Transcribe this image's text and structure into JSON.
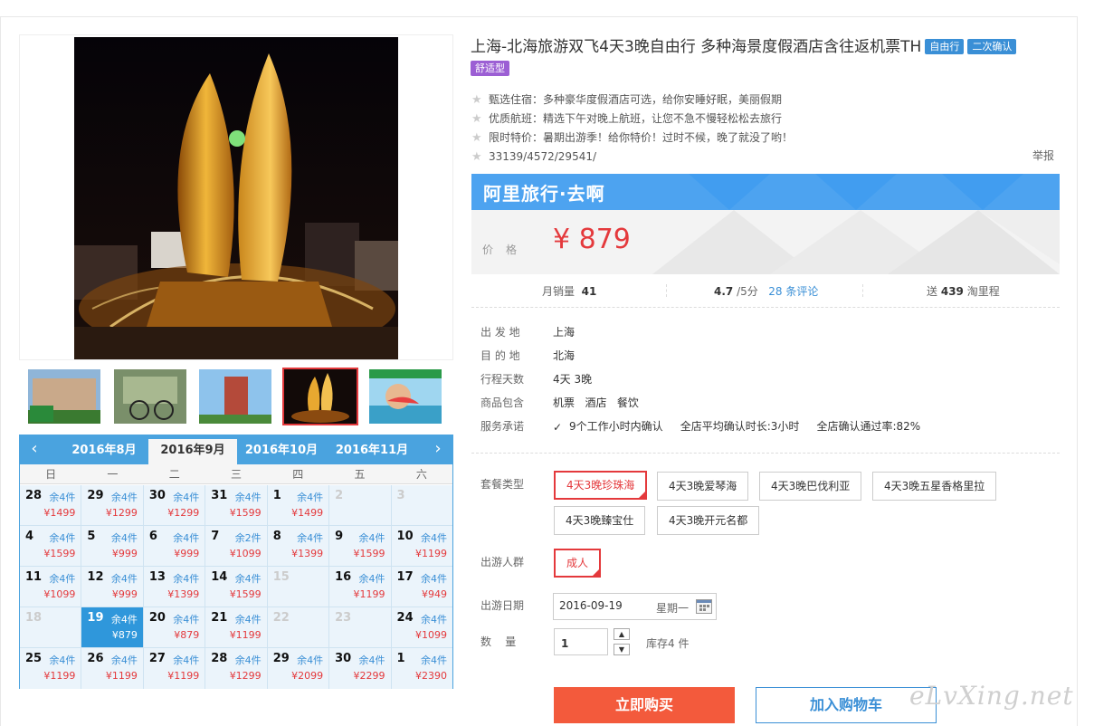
{
  "product": {
    "title": "上海-北海旅游双飞4天3晚自由行 多种海景度假酒店含往返机票TH",
    "tags": [
      "自由行",
      "二次确认",
      "舒适型"
    ],
    "features": [
      "甄选住宿：多种豪华度假酒店可选，给你安睡好眠，美丽假期",
      "优质航班：精选下午对晚上航班，让您不急不慢轻松松去旅行",
      "限时特价：暑期出游季！给你特价！过时不候，晚了就没了哟！",
      "33139/4572/29541/"
    ],
    "report": "举报"
  },
  "banner": {
    "brand": "阿里旅行·去啊",
    "price_label": "价格",
    "price": "¥ 879",
    "accent": "#3f9cf0",
    "price_color": "#e4393c"
  },
  "stats": {
    "sales_label": "月销量",
    "sales": "41",
    "rating": "4.7",
    "rating_suffix": "/5分",
    "reviews": "28 条评论",
    "points_pre": "送",
    "points": "439",
    "points_suf": "淘里程"
  },
  "info": [
    {
      "k": "出 发 地",
      "v": "上海"
    },
    {
      "k": "目 的 地",
      "v": "北海"
    },
    {
      "k": "行程天数",
      "v": "4天 3晚"
    },
    {
      "k": "商品包含",
      "v": "机票   酒店   餐饮"
    },
    {
      "k": "服务承诺",
      "v": "9个工作小时内确认     全店平均确认时长:3小时     全店确认通过率:82%"
    }
  ],
  "options": {
    "package_label": "套餐类型",
    "packages": [
      "4天3晚珍珠海",
      "4天3晚爱琴海",
      "4天3晚巴伐利亚",
      "4天3晚五星香格里拉",
      "4天3晚臻宝仕",
      "4天3晚开元名都"
    ],
    "crowd_label": "出游人群",
    "crowd": "成人",
    "date_label": "出游日期",
    "date": "2016-09-19",
    "weekday": "星期一",
    "qty_label": "数    量",
    "qty": "1",
    "stock": "库存4 件"
  },
  "actions": {
    "buy": "立即购买",
    "cart": "加入购物车"
  },
  "watermark": "eLvXing.net",
  "calendar": {
    "prev": "‹",
    "next": "›",
    "months": [
      "2016年8月",
      "2016年9月",
      "2016年10月",
      "2016年11月"
    ],
    "active_month": 1,
    "weekdays": [
      "日",
      "一",
      "二",
      "三",
      "四",
      "五",
      "六"
    ],
    "weeks": [
      [
        {
          "d": "28",
          "s": "余4件",
          "p": "¥1499"
        },
        {
          "d": "29",
          "s": "余4件",
          "p": "¥1299"
        },
        {
          "d": "30",
          "s": "余4件",
          "p": "¥1299"
        },
        {
          "d": "31",
          "s": "余4件",
          "p": "¥1599"
        },
        {
          "d": "1",
          "s": "余4件",
          "p": "¥1499"
        },
        {
          "d": "2",
          "na": true
        },
        {
          "d": "3",
          "na": true
        }
      ],
      [
        {
          "d": "4",
          "s": "余4件",
          "p": "¥1599"
        },
        {
          "d": "5",
          "s": "余4件",
          "p": "¥999"
        },
        {
          "d": "6",
          "s": "余4件",
          "p": "¥999"
        },
        {
          "d": "7",
          "s": "余2件",
          "p": "¥1099"
        },
        {
          "d": "8",
          "s": "余4件",
          "p": "¥1399"
        },
        {
          "d": "9",
          "s": "余4件",
          "p": "¥1599"
        },
        {
          "d": "10",
          "s": "余4件",
          "p": "¥1199"
        }
      ],
      [
        {
          "d": "11",
          "s": "余4件",
          "p": "¥1099"
        },
        {
          "d": "12",
          "s": "余4件",
          "p": "¥999"
        },
        {
          "d": "13",
          "s": "余4件",
          "p": "¥1399"
        },
        {
          "d": "14",
          "s": "余4件",
          "p": "¥1599"
        },
        {
          "d": "15",
          "na": true
        },
        {
          "d": "16",
          "s": "余4件",
          "p": "¥1199"
        },
        {
          "d": "17",
          "s": "余4件",
          "p": "¥949"
        }
      ],
      [
        {
          "d": "18",
          "na": true
        },
        {
          "d": "19",
          "s": "余4件",
          "p": "¥879",
          "sel": true
        },
        {
          "d": "20",
          "s": "余4件",
          "p": "¥879"
        },
        {
          "d": "21",
          "s": "余4件",
          "p": "¥1199"
        },
        {
          "d": "22",
          "na": true
        },
        {
          "d": "23",
          "na": true
        },
        {
          "d": "24",
          "s": "余4件",
          "p": "¥1099"
        }
      ],
      [
        {
          "d": "25",
          "s": "余4件",
          "p": "¥1199"
        },
        {
          "d": "26",
          "s": "余4件",
          "p": "¥1199"
        },
        {
          "d": "27",
          "s": "余4件",
          "p": "¥1199"
        },
        {
          "d": "28",
          "s": "余4件",
          "p": "¥1299"
        },
        {
          "d": "29",
          "s": "余4件",
          "p": "¥2099"
        },
        {
          "d": "30",
          "s": "余4件",
          "p": "¥2299"
        },
        {
          "d": "1",
          "s": "余4件",
          "p": "¥2390"
        }
      ]
    ]
  }
}
